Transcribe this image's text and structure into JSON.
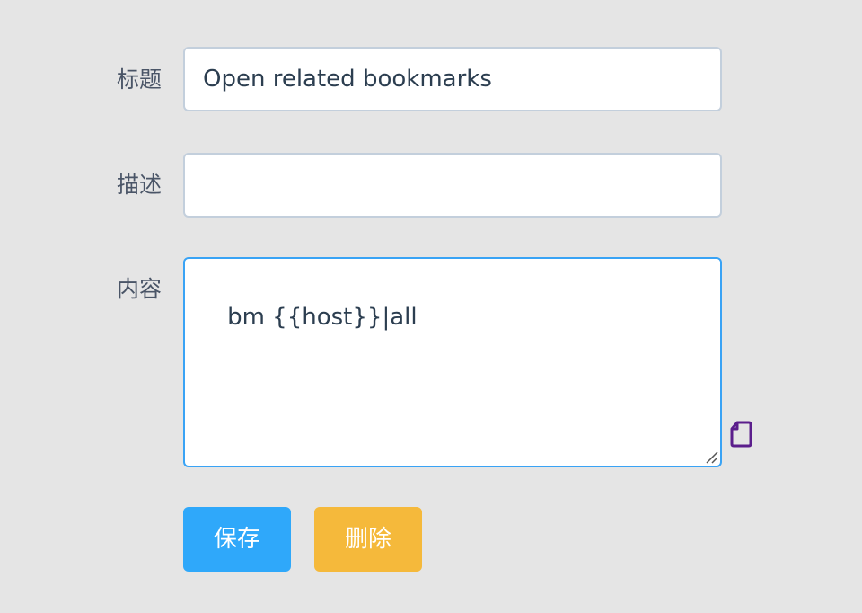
{
  "form": {
    "title_label": "标题",
    "title_value": "Open related bookmarks",
    "description_label": "描述",
    "description_value": "",
    "content_label": "内容",
    "content_value": "bm {{host}}|all"
  },
  "actions": {
    "save_label": "保存",
    "delete_label": "删除"
  },
  "icons": {
    "side_icon": "page-icon",
    "resize": "resize-grip-icon"
  },
  "colors": {
    "background": "#e5e5e5",
    "input_border": "#c3cfdc",
    "focus_border": "#39a3f5",
    "save_button": "#2fa8fa",
    "delete_button": "#f5b93b",
    "page_icon": "#5b1e8c",
    "text": "#2c3e50"
  }
}
